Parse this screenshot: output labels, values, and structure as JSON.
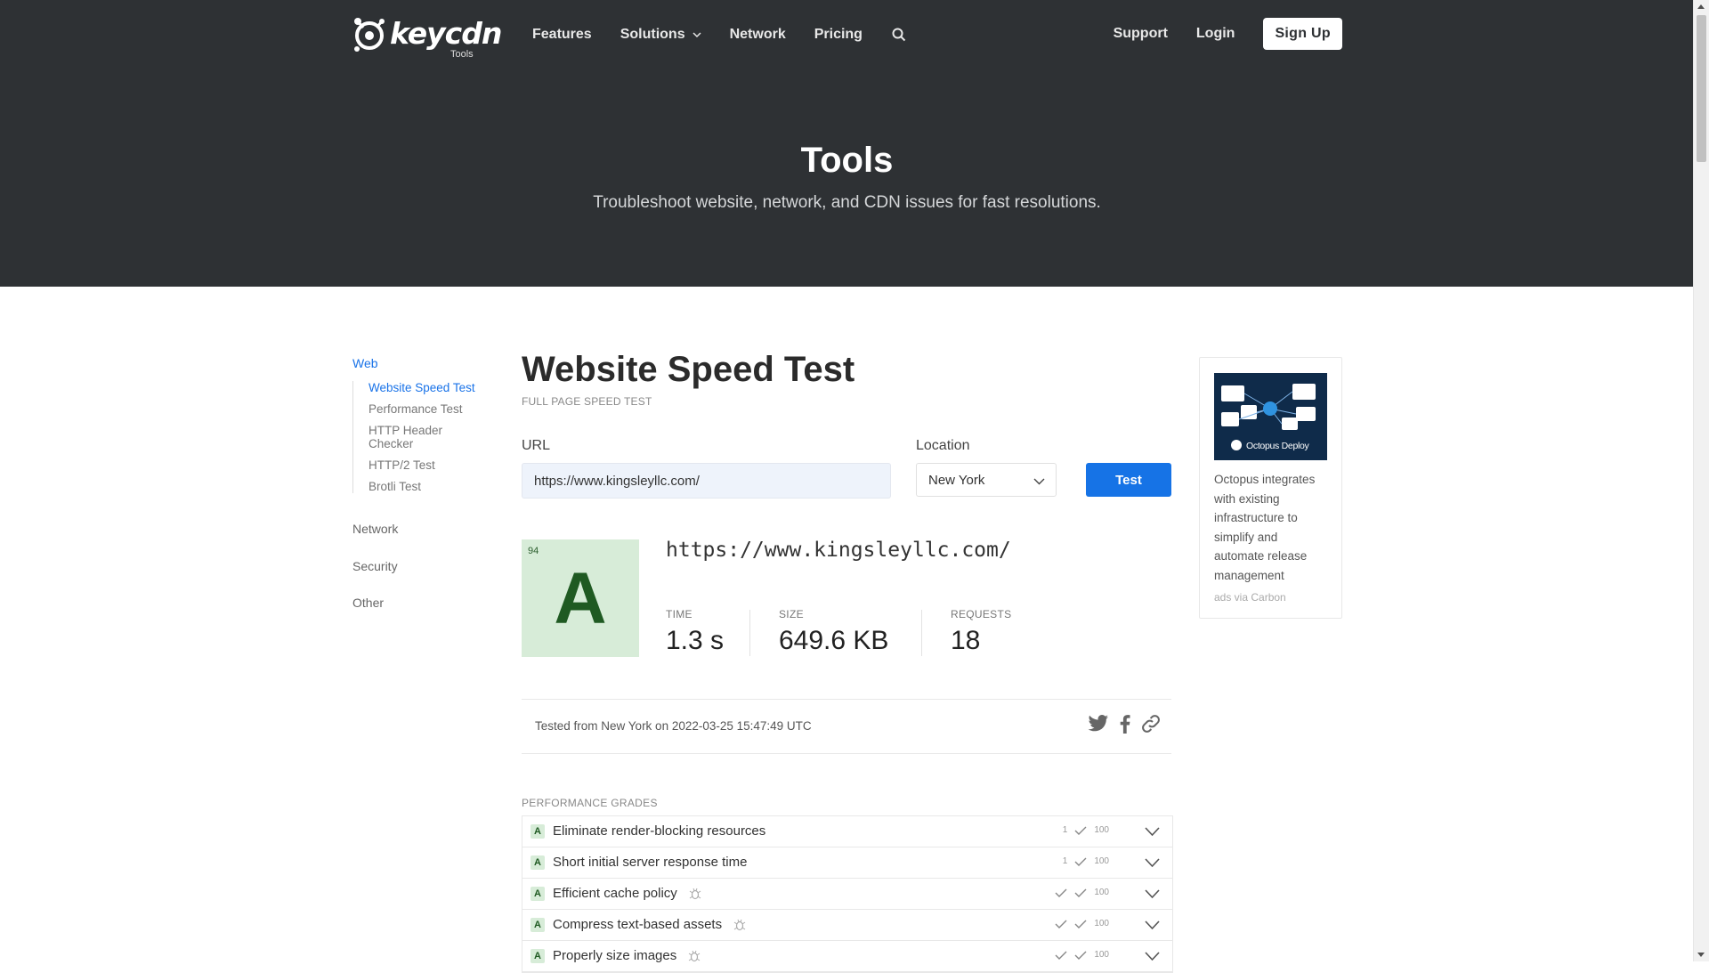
{
  "header": {
    "logo_text": "keycdn",
    "logo_sub": "Tools",
    "nav": [
      {
        "label": "Features"
      },
      {
        "label": "Solutions"
      },
      {
        "label": "Network"
      },
      {
        "label": "Pricing"
      }
    ],
    "right_nav": [
      {
        "label": "Support"
      },
      {
        "label": "Login"
      }
    ],
    "signup_label": "Sign Up",
    "icons": {
      "search": "search-icon",
      "dropdown": "chevron-down-icon"
    }
  },
  "hero": {
    "title": "Tools",
    "subtitle": "Troubleshoot website, network, and CDN issues for fast resolutions."
  },
  "sidebar": {
    "categories": [
      {
        "label": "Web",
        "active": true,
        "items": [
          {
            "label": "Website Speed Test",
            "active": true
          },
          {
            "label": "Performance Test"
          },
          {
            "label": "HTTP Header Checker"
          },
          {
            "label": "HTTP/2 Test"
          },
          {
            "label": "Brotli Test"
          }
        ]
      },
      {
        "label": "Network"
      },
      {
        "label": "Security"
      },
      {
        "label": "Other"
      }
    ]
  },
  "main": {
    "title": "Website Speed Test",
    "subtitle": "FULL PAGE SPEED TEST",
    "url_label": "URL",
    "url_value": "https://www.kingsleyllc.com/",
    "location_label": "Location",
    "location_value": "New York",
    "test_button": "Test",
    "result": {
      "score": "94",
      "grade": "A",
      "url": "https://www.kingsleyllc.com/",
      "metrics": [
        {
          "label": "TIME",
          "value": "1.3 s"
        },
        {
          "label": "SIZE",
          "value": "649.6 KB"
        },
        {
          "label": "REQUESTS",
          "value": "18"
        }
      ]
    },
    "tested_text": "Tested from New York on 2022-03-25 15:47:49 UTC",
    "share_icons": [
      "twitter-icon",
      "facebook-icon",
      "link-icon"
    ],
    "performance": {
      "title": "PERFORMANCE GRADES",
      "rows": [
        {
          "grade": "A",
          "name": "Eliminate render-blocking resources",
          "count": "1",
          "score": "100",
          "bug": false
        },
        {
          "grade": "A",
          "name": "Short initial server response time",
          "count": "1",
          "score": "100",
          "bug": false
        },
        {
          "grade": "A",
          "name": "Efficient cache policy",
          "count": "",
          "score": "100",
          "bug": true
        },
        {
          "grade": "A",
          "name": "Compress text-based assets",
          "count": "",
          "score": "100",
          "bug": true
        },
        {
          "grade": "A",
          "name": "Properly size images",
          "count": "",
          "score": "100",
          "bug": true
        }
      ]
    }
  },
  "ad": {
    "image_text": "Octopus Deploy",
    "text": "Octopus integrates with existing infrastructure to simplify and automate release management",
    "via": "ads via Carbon"
  }
}
